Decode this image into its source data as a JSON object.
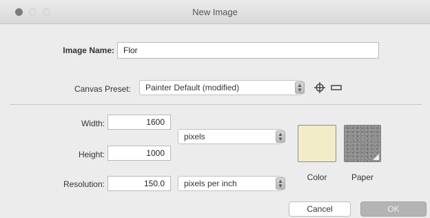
{
  "window": {
    "title": "New Image"
  },
  "image_name": {
    "label": "Image Name:",
    "value": "Flor"
  },
  "canvas_preset": {
    "label": "Canvas Preset:",
    "value": "Painter Default (modified)"
  },
  "width": {
    "label": "Width:",
    "value": "1600"
  },
  "height": {
    "label": "Height:",
    "value": "1000"
  },
  "size_unit": {
    "value": "pixels"
  },
  "resolution": {
    "label": "Resolution:",
    "value": "150.0",
    "unit": "pixels per inch"
  },
  "color_swatch": {
    "label": "Color",
    "color": "#f3ecc9"
  },
  "paper_swatch": {
    "label": "Paper"
  },
  "buttons": {
    "cancel": "Cancel",
    "ok": "OK"
  }
}
